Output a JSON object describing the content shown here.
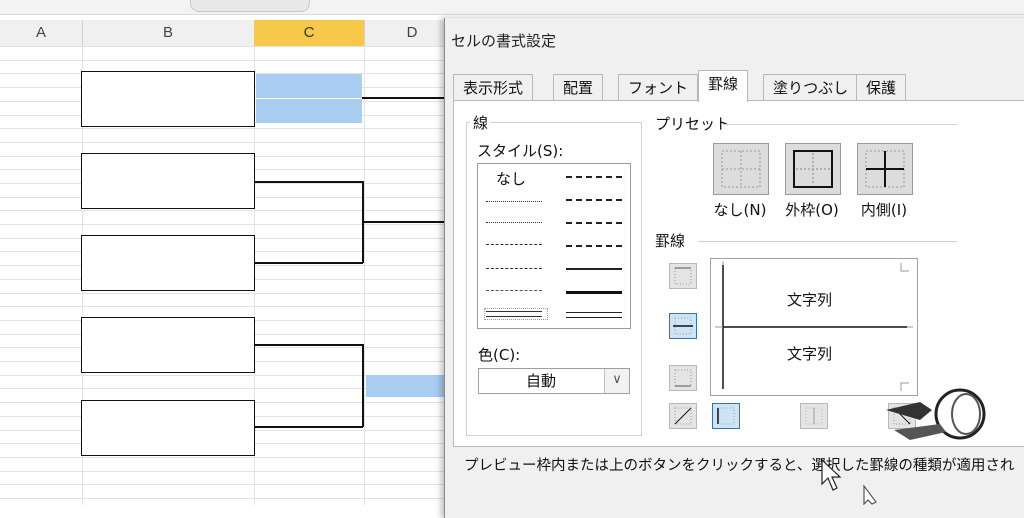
{
  "sheet": {
    "columns": [
      {
        "label": "A",
        "selected": false
      },
      {
        "label": "B",
        "selected": false
      },
      {
        "label": "C",
        "selected": true
      },
      {
        "label": "D",
        "selected": false
      }
    ]
  },
  "dialog": {
    "title": "セルの書式設定",
    "tabs": [
      "表示形式",
      "配置",
      "フォント",
      "罫線",
      "塗りつぶし",
      "保護"
    ],
    "active_tab": "罫線",
    "line_group": {
      "label": "線",
      "style_label": "スタイル(S):",
      "none_label": "なし",
      "color_label": "色(C):",
      "color_value": "自動"
    },
    "presets": {
      "label": "プリセット",
      "items": [
        "なし(N)",
        "外枠(O)",
        "内側(I)"
      ]
    },
    "border": {
      "label": "罫線",
      "preview_text_top": "文字列",
      "preview_text_bottom": "文字列"
    },
    "hint": "プレビュー枠内または上のボタンをクリックすると、選択した罫線の種類が適用され"
  },
  "colors": {
    "selected_column": "#f6c94a",
    "cell_highlight": "#a8cdf0",
    "active_button": "#cfe3f7"
  }
}
